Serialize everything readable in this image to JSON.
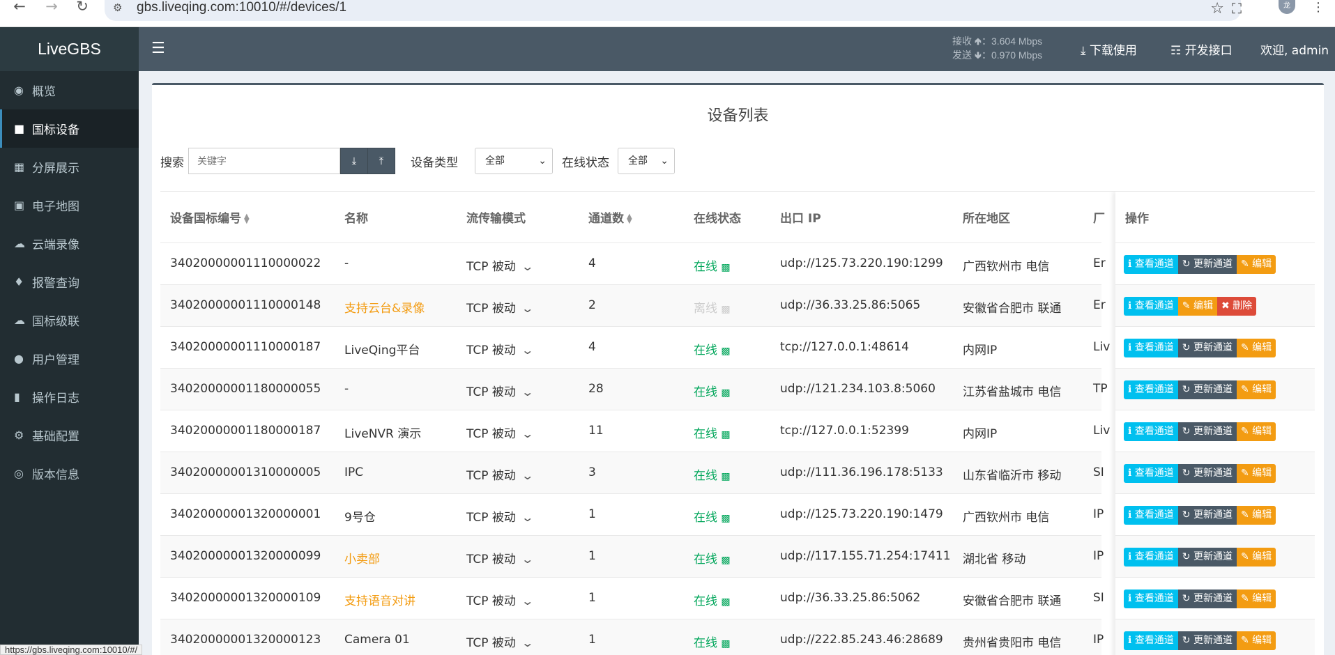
{
  "browser": {
    "url": "gbs.liveqing.com:10010/#/devices/1",
    "status_url": "https://gbs.liveqing.com:10010/#/",
    "profile_initial": "龙"
  },
  "sidebar": {
    "brand": "LiveGBS",
    "items": [
      {
        "label": "概览",
        "icon": "dashboard-icon"
      },
      {
        "label": "国标设备",
        "icon": "video-camera-icon"
      },
      {
        "label": "分屏展示",
        "icon": "grid-icon"
      },
      {
        "label": "电子地图",
        "icon": "map-icon"
      },
      {
        "label": "云端录像",
        "icon": "cloud-icon"
      },
      {
        "label": "报警查询",
        "icon": "bell-icon"
      },
      {
        "label": "国标级联",
        "icon": "cloud-upload-icon"
      },
      {
        "label": "用户管理",
        "icon": "users-icon"
      },
      {
        "label": "操作日志",
        "icon": "file-icon"
      },
      {
        "label": "基础配置",
        "icon": "gears-icon"
      },
      {
        "label": "版本信息",
        "icon": "lifebuoy-icon"
      }
    ]
  },
  "header": {
    "recv_label": "接收",
    "recv_value": "：3.604 Mbps",
    "send_label": "发送",
    "send_value": "：0.970 Mbps",
    "download": "下载使用",
    "api": "开发接口",
    "welcome": "欢迎, admin"
  },
  "main": {
    "title": "设备列表",
    "search_label": "搜索",
    "search_placeholder": "关键字",
    "type_label": "设备类型",
    "type_value": "全部",
    "status_label": "在线状态",
    "status_value": "全部"
  },
  "table": {
    "headers": {
      "id": "设备国标编号",
      "name": "名称",
      "mode": "流传输模式",
      "channels": "通道数",
      "status": "在线状态",
      "ip": "出口 IP",
      "region": "所在地区",
      "vendor": "厂",
      "action": "操作"
    },
    "buttons": {
      "view": "查看通道",
      "refresh": "更新通道",
      "edit": "编辑",
      "delete": "删除"
    },
    "rows": [
      {
        "id": "34020000001110000022",
        "name": "-",
        "mode": "TCP 被动",
        "channels": "4",
        "status": "在线",
        "ip": "udp://125.73.220.190:1299",
        "region": "广西钦州市 电信",
        "vendor": "Er"
      },
      {
        "id": "34020000001110000148",
        "name": "支持云台&录像",
        "mode": "TCP 被动",
        "channels": "2",
        "status": "离线",
        "ip": "udp://36.33.25.86:5065",
        "region": "安徽省合肥市 联通",
        "vendor": "Er"
      },
      {
        "id": "34020000001110000187",
        "name": "LiveQing平台",
        "mode": "TCP 被动",
        "channels": "4",
        "status": "在线",
        "ip": "tcp://127.0.0.1:48614",
        "region": "内网IP",
        "vendor": "Liv"
      },
      {
        "id": "34020000001180000055",
        "name": "-",
        "mode": "TCP 被动",
        "channels": "28",
        "status": "在线",
        "ip": "udp://121.234.103.8:5060",
        "region": "江苏省盐城市 电信",
        "vendor": "TP"
      },
      {
        "id": "34020000001180000187",
        "name": "LiveNVR 演示",
        "mode": "TCP 被动",
        "channels": "11",
        "status": "在线",
        "ip": "tcp://127.0.0.1:52399",
        "region": "内网IP",
        "vendor": "Liv"
      },
      {
        "id": "34020000001310000005",
        "name": "IPC",
        "mode": "TCP 被动",
        "channels": "3",
        "status": "在线",
        "ip": "udp://111.36.196.178:5133",
        "region": "山东省临沂市 移动",
        "vendor": "SI"
      },
      {
        "id": "34020000001320000001",
        "name": "9号仓",
        "mode": "TCP 被动",
        "channels": "1",
        "status": "在线",
        "ip": "udp://125.73.220.190:1479",
        "region": "广西钦州市 电信",
        "vendor": "IP"
      },
      {
        "id": "34020000001320000099",
        "name": "小卖部",
        "mode": "TCP 被动",
        "channels": "1",
        "status": "在线",
        "ip": "udp://117.155.71.254:17411",
        "region": "湖北省 移动",
        "vendor": "IP"
      },
      {
        "id": "34020000001320000109",
        "name": "支持语音对讲",
        "mode": "TCP 被动",
        "channels": "1",
        "status": "在线",
        "ip": "udp://36.33.25.86:5062",
        "region": "安徽省合肥市 联通",
        "vendor": "SI"
      },
      {
        "id": "34020000001320000123",
        "name": "Camera 01",
        "mode": "TCP 被动",
        "channels": "1",
        "status": "在线",
        "ip": "udp://222.85.243.46:28689",
        "region": "贵州省贵阳市 电信",
        "vendor": "IP"
      }
    ]
  }
}
